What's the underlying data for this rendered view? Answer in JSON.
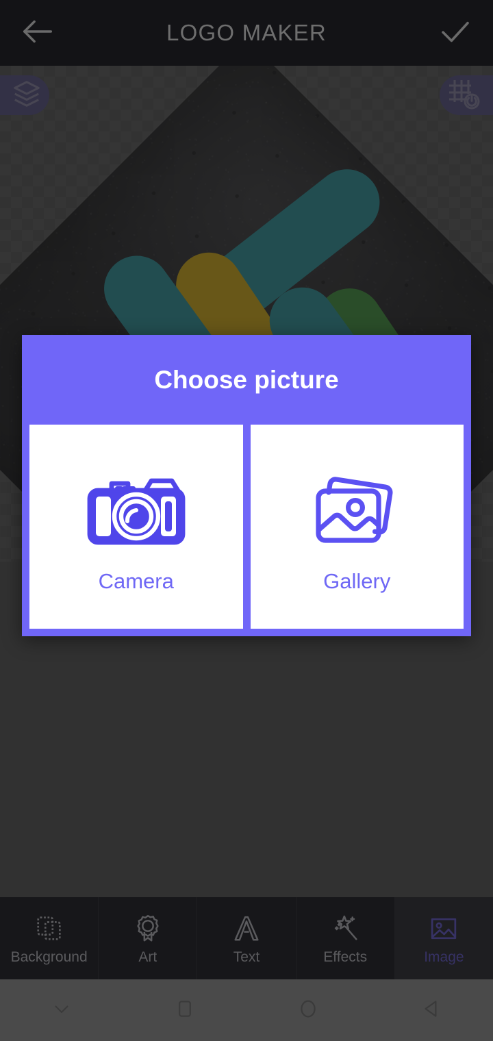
{
  "appbar": {
    "back_icon": "arrow-left-icon",
    "title": "LOGO MAKER",
    "done_icon": "check-icon"
  },
  "canvas": {
    "layers_chip": {
      "icon": "layers-icon",
      "label": ""
    },
    "grid_chip": {
      "icon": "grid-power-icon",
      "label": ""
    },
    "artwork_description": "abstract logo on dark textured diamond"
  },
  "dialog": {
    "title": "Choose picture",
    "accent_color": "#7066f8",
    "options": [
      {
        "icon": "camera-icon",
        "label": "Camera"
      },
      {
        "icon": "gallery-icon",
        "label": "Gallery"
      }
    ]
  },
  "toolbar": {
    "selected_index": 4,
    "items": [
      {
        "icon": "background-icon",
        "label": "Background"
      },
      {
        "icon": "art-badge-icon",
        "label": "Art"
      },
      {
        "icon": "text-a-icon",
        "label": "Text"
      },
      {
        "icon": "effects-wand-icon",
        "label": "Effects"
      },
      {
        "icon": "image-icon",
        "label": "Image"
      }
    ]
  },
  "navbar": {
    "items": [
      {
        "icon": "chevron-down-icon",
        "label": ""
      },
      {
        "icon": "square-recents-icon",
        "label": ""
      },
      {
        "icon": "circle-home-icon",
        "label": ""
      },
      {
        "icon": "triangle-back-icon",
        "label": ""
      }
    ]
  }
}
